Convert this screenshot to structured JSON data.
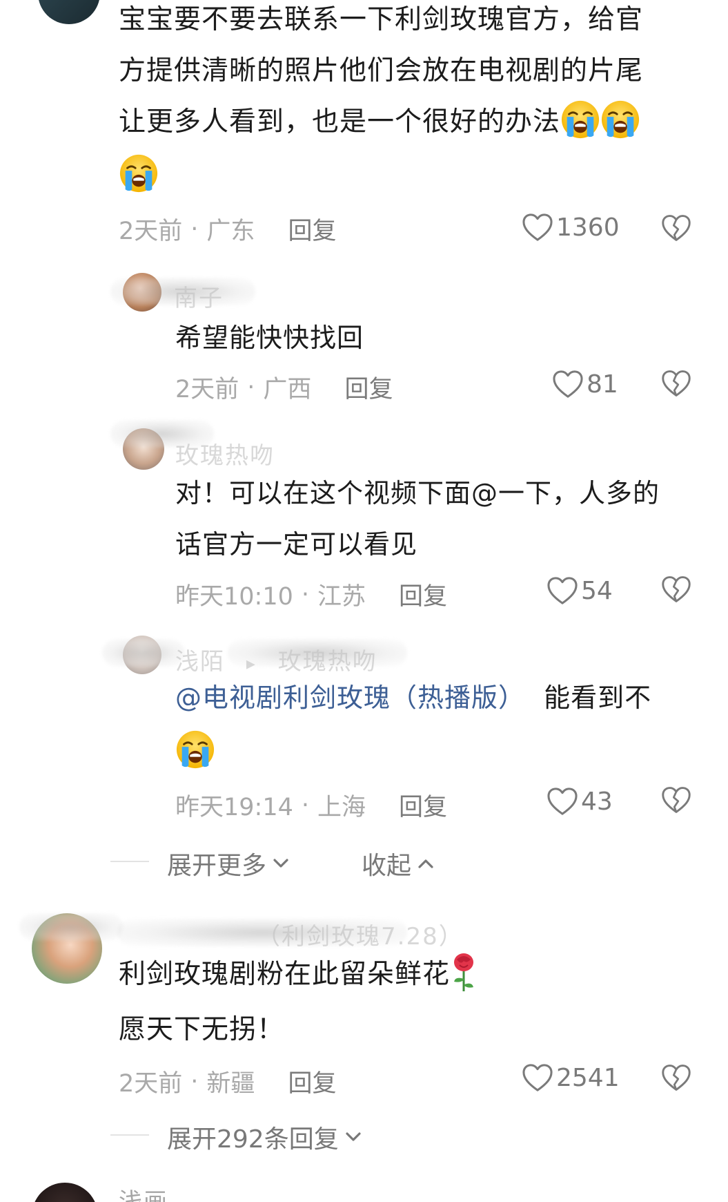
{
  "comment1": {
    "lines": [
      "宝宝要不要去联系一下利剑玫瑰官方，给官",
      "方提供清晰的照片他们会放在电视剧的片尾",
      "让更多人看到，也是一个很好的办法"
    ],
    "time": "2天前",
    "sep": "·",
    "location": "广东",
    "reply": "回复",
    "likes": "1360"
  },
  "reply1": {
    "name": "南子",
    "text": "希望能快快找回",
    "time": "2天前",
    "sep": "·",
    "location": "广西",
    "reply": "回复",
    "likes": "81"
  },
  "reply2": {
    "name": "玫瑰热吻",
    "line1": "对！可以在这个视频下面@一下，人多的",
    "line2": "话官方一定可以看见",
    "time": "昨天10:10",
    "sep": "·",
    "location": "江苏",
    "reply": "回复",
    "likes": "54"
  },
  "reply3": {
    "name": "浅陌",
    "arrow": "▸",
    "target": "玫瑰热吻",
    "mention": "@电视剧利剑玫瑰（热播版）",
    "text": "能看到不",
    "time": "昨天19:14",
    "sep": "·",
    "location": "上海",
    "reply": "回复",
    "likes": "43"
  },
  "thread_controls": {
    "expand_more": "展开更多",
    "collapse": "收起"
  },
  "comment2": {
    "name": "（利剑玫瑰7.28）",
    "line1": "利剑玫瑰剧粉在此留朵鲜花",
    "line2": "愿天下无拐！",
    "time": "2天前",
    "sep": "·",
    "location": "新疆",
    "reply": "回复",
    "likes": "2541",
    "expand_replies": "展开292条回复"
  },
  "comment3": {
    "name": "浅画"
  },
  "icons": {
    "like": "heart-outline-icon",
    "dislike": "broken-heart-icon",
    "crying": "loudly-crying-face-emoji",
    "rose": "rose-emoji",
    "chevron_down": "chevron-down-icon",
    "chevron_up": "chevron-up-icon"
  },
  "colors": {
    "mention": "#3d5f95",
    "meta": "#a9a9a9",
    "reply_btn": "#7b7b7b"
  }
}
